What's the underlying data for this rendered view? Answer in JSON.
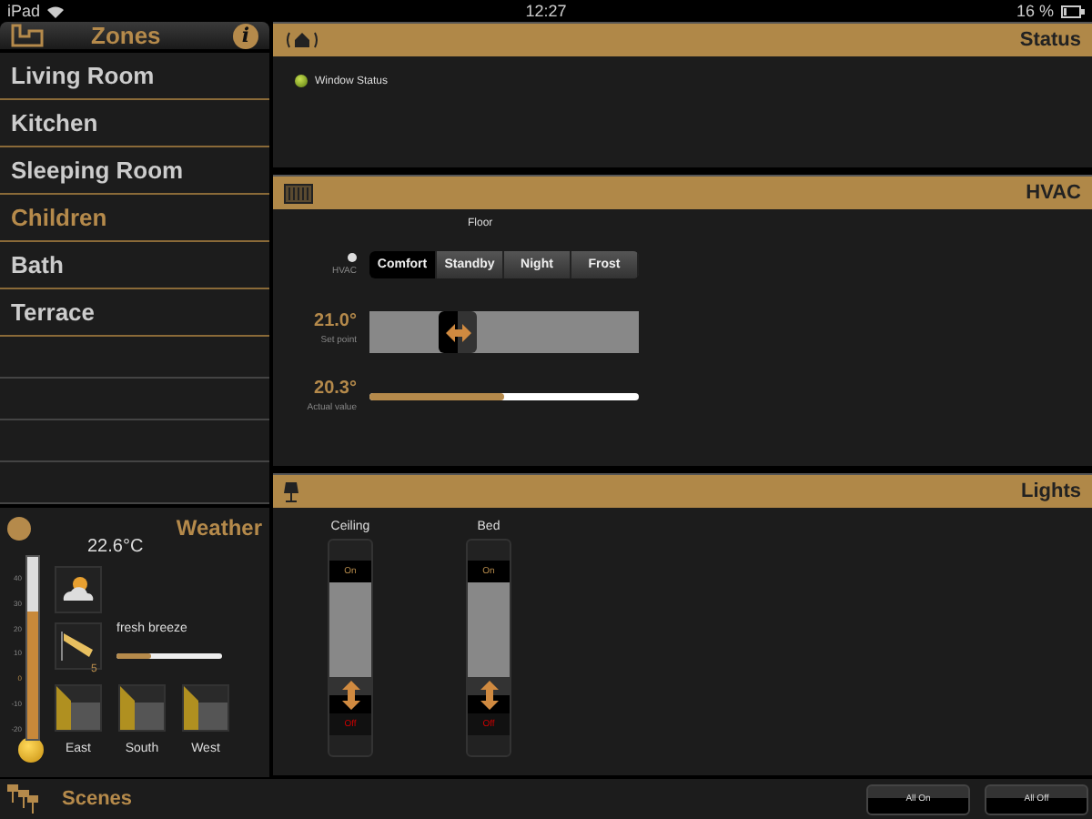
{
  "status_bar": {
    "device": "iPad",
    "time": "12:27",
    "battery": "16 %"
  },
  "zones": {
    "title": "Zones",
    "info": "i",
    "items": [
      {
        "label": "Living Room",
        "selected": false
      },
      {
        "label": "Kitchen",
        "selected": false
      },
      {
        "label": "Sleeping Room",
        "selected": false
      },
      {
        "label": "Children",
        "selected": true
      },
      {
        "label": "Bath",
        "selected": false
      },
      {
        "label": "Terrace",
        "selected": false
      }
    ]
  },
  "weather": {
    "title": "Weather",
    "temperature": "22.6°C",
    "scale": [
      "40",
      "30",
      "20",
      "10",
      "0",
      "-10",
      "-20"
    ],
    "thermometer": {
      "level": 0.7
    },
    "wind": {
      "label": "fresh breeze",
      "force": "5",
      "level": 0.33
    },
    "shades": [
      "East",
      "South",
      "West"
    ]
  },
  "status": {
    "title": "Status",
    "items": [
      {
        "label": "Window Status"
      }
    ]
  },
  "hvac": {
    "title": "HVAC",
    "zone": "Floor",
    "mode_label": "HVAC",
    "modes": [
      {
        "label": "Comfort",
        "selected": true
      },
      {
        "label": "Standby",
        "selected": false
      },
      {
        "label": "Night",
        "selected": false
      },
      {
        "label": "Frost",
        "selected": false
      }
    ],
    "setpoint": {
      "value": "21.0°",
      "label": "Set point",
      "level": 0.3
    },
    "actual": {
      "value": "20.3°",
      "label": "Actual value",
      "level": 0.5
    }
  },
  "lights": {
    "title": "Lights",
    "items": [
      {
        "label": "Ceiling",
        "on_label": "On",
        "off_label": "Off",
        "level": 0
      },
      {
        "label": "Bed",
        "on_label": "On",
        "off_label": "Off",
        "level": 0
      }
    ]
  },
  "scenes": {
    "title": "Scenes",
    "buttons": [
      "All On",
      "All Off"
    ]
  }
}
